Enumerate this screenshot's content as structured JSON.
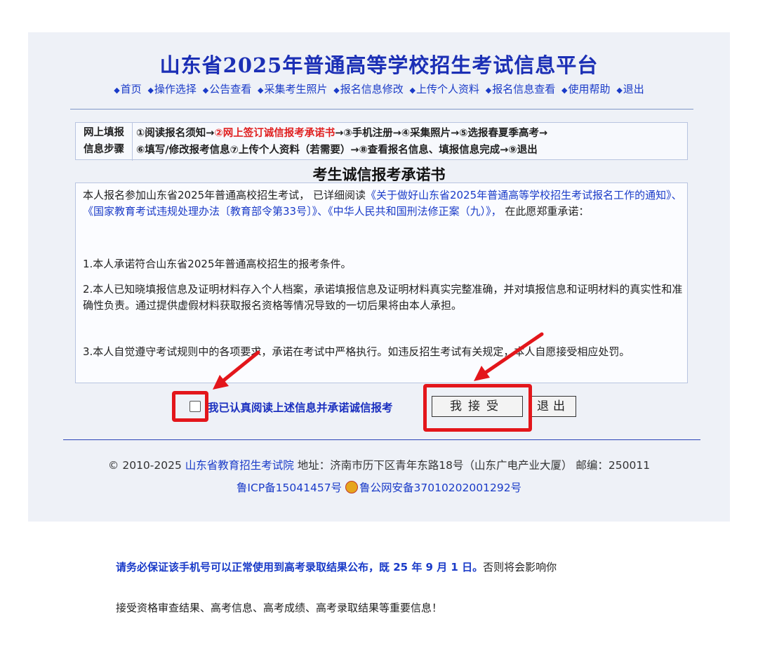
{
  "header": {
    "title": "山东省2025年普通高等学校招生考试信息平台",
    "nav": [
      "首页",
      "操作选择",
      "公告查看",
      "采集考生照片",
      "报名信息修改",
      "上传个人资料",
      "报名信息查看",
      "使用帮助",
      "退出"
    ]
  },
  "steps": {
    "label_line1": "网上填报",
    "label_line2": "信息步骤",
    "step1": "①阅读报名须知→",
    "step2": "②网上签订诚信报考承诺书",
    "step2_arrow": "→",
    "step3to5": "③手机注册→④采集照片→⑤选报春夏季高考→",
    "line2": "⑥填写/修改报考信息⑦上传个人资料（若需要）→⑧查看报名信息、填报信息完成→⑨退出"
  },
  "letter": {
    "title": "考生诚信报考承诺书",
    "p1_prefix": "本人报名参加山东省2025年普通高校招生考试，  已详细阅读",
    "p1_links": "《关于做好山东省2025年普通高等学校招生考试报名工作的通知》、《国家教育考试违规处理办法〔教育部令第33号〕》、《中华人民共和国刑法修正案（九）》，",
    "p1_suffix": "  在此愿郑重承诺：",
    "p2": "1.本人承诺符合山东省2025年普通高校招生的报考条件。",
    "p3": "2.本人已知晓填报信息及证明材料存入个人档案，承诺填报信息及证明材料真实完整准确，并对填报信息和证明材料的真实性和准确性负责。通过提供虚假材料获取报名资格等情况导致的一切后果将由本人承担。",
    "p4": "3.本人自觉遵守考试规则中的各项要求，承诺在考试中严格执行。如违反招生考试有关规定，本人自愿接受相应处罚。"
  },
  "confirm": {
    "checkbox_label": "我已认真阅读上述信息并承诺诚信报考",
    "checkbox_checked": false,
    "accept_button": "我接受",
    "exit_button": "退出"
  },
  "footer": {
    "copyright": "© 2010-2025",
    "org": "山东省教育招生考试院",
    "address": "地址：济南市历下区青年东路18号（山东广电产业大厦） 邮编：250011",
    "icp": "鲁ICP备15041457号",
    "police": "鲁公网安备37010202001292号"
  },
  "notice": {
    "highlight": "请务必保证该手机号可以正常使用到高考录取结果公布，既 25 年 9 月 1 日。",
    "rest": "否则将会影响你",
    "line2": "接受资格审查结果、高考信息、高考成绩、高考录取结果等重要信息！"
  },
  "colors": {
    "title": "#1b2fb5",
    "link": "#1a3bc8",
    "current_step": "#e02020",
    "annotation": "#e3161b",
    "panel_bg": "#eef1f7"
  }
}
